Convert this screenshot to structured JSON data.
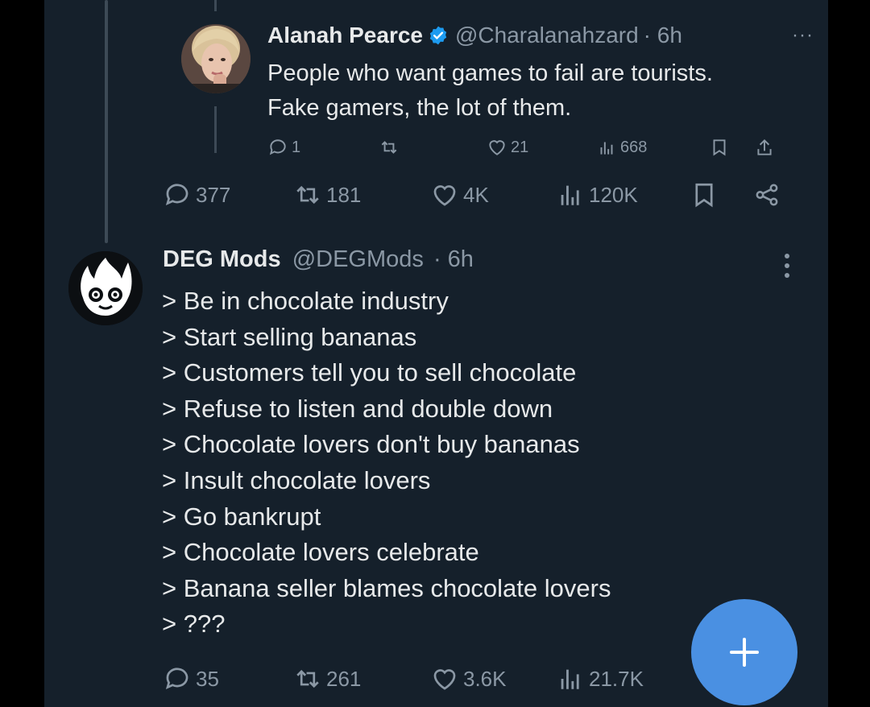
{
  "quoted_tweet": {
    "author_name": "Alanah Pearce",
    "handle": "@Charalanahzard",
    "time": "· 6h",
    "more_label": "···",
    "text_lines": [
      "People who want games to fail are tourists.",
      "Fake gamers, the lot of them."
    ],
    "actions": {
      "replies": "1",
      "reposts": "",
      "likes": "21",
      "views": "668"
    }
  },
  "quoted_stats": {
    "replies": "377",
    "reposts": "181",
    "likes": "4K",
    "views": "120K"
  },
  "main_tweet": {
    "author_name": "DEG Mods",
    "handle": "@DEGMods",
    "time": "· 6h",
    "lines": [
      "> Be in chocolate industry",
      "> Start selling bananas",
      "> Customers tell you to sell chocolate",
      "> Refuse to listen and double down",
      "> Chocolate lovers don't buy bananas",
      "> Insult chocolate lovers",
      "> Go bankrupt",
      "> Chocolate lovers celebrate",
      "> Banana seller blames chocolate lovers",
      "> ???"
    ],
    "stats": {
      "replies": "35",
      "reposts": "261",
      "likes": "3.6K",
      "views": "21.7K"
    }
  },
  "compose_button": {
    "icon": "plus-icon"
  },
  "colors": {
    "background": "#15202b",
    "text_primary": "#e7e9ea",
    "text_secondary": "#8b98a5",
    "verified_blue": "#1d9bf0",
    "fab_blue": "#4a90e2"
  }
}
